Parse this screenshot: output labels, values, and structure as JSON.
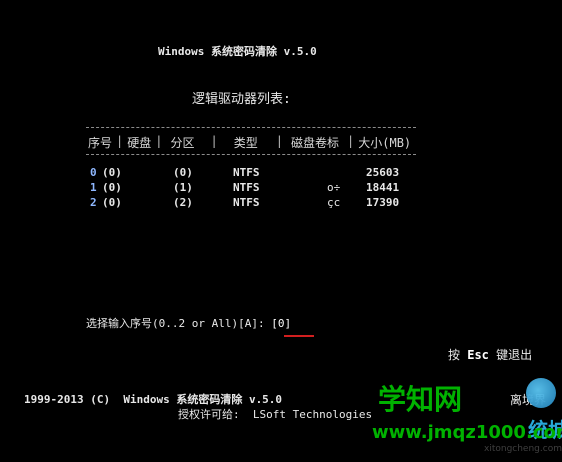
{
  "window_title": "Windows 系统密码清除 v.5.0",
  "subtitle": "逻辑驱动器列表:",
  "table": {
    "headers": [
      "序号",
      "硬盘",
      "分区",
      "类型",
      "磁盘卷标",
      "大小(MB)"
    ],
    "rows": [
      {
        "num": "0",
        "disk": "(0)",
        "part": "(0)",
        "type": "NTFS",
        "label": "",
        "size": "25603"
      },
      {
        "num": "1",
        "disk": "(0)",
        "part": "(1)",
        "type": "NTFS",
        "label": "o÷",
        "size": "18441"
      },
      {
        "num": "2",
        "disk": "(0)",
        "part": "(2)",
        "type": "NTFS",
        "label": "çc",
        "size": "17390"
      }
    ]
  },
  "prompt": {
    "text": "选择输入序号(0..2 or All)[A]: ",
    "value": "[0]"
  },
  "exit_hint": {
    "prefix": "按 ",
    "key": "Esc",
    "suffix": " 键退出"
  },
  "footer": {
    "line1": "1999-2013 (C)  Windows 系统密码清除 v.5.0",
    "line2": "授权许可给:  LSoft Technologies",
    "right_text": "离境界"
  },
  "watermark": {
    "brand": "学知网",
    "url": "www.jmqz1000.com",
    "city_text": "统城",
    "sub": "xitongcheng.com"
  },
  "colors": {
    "background": "#000000",
    "text": "#e8e8e8",
    "index_color": "#8fb8ff",
    "underline": "#d21f1f",
    "watermark_green": "#00b200"
  }
}
